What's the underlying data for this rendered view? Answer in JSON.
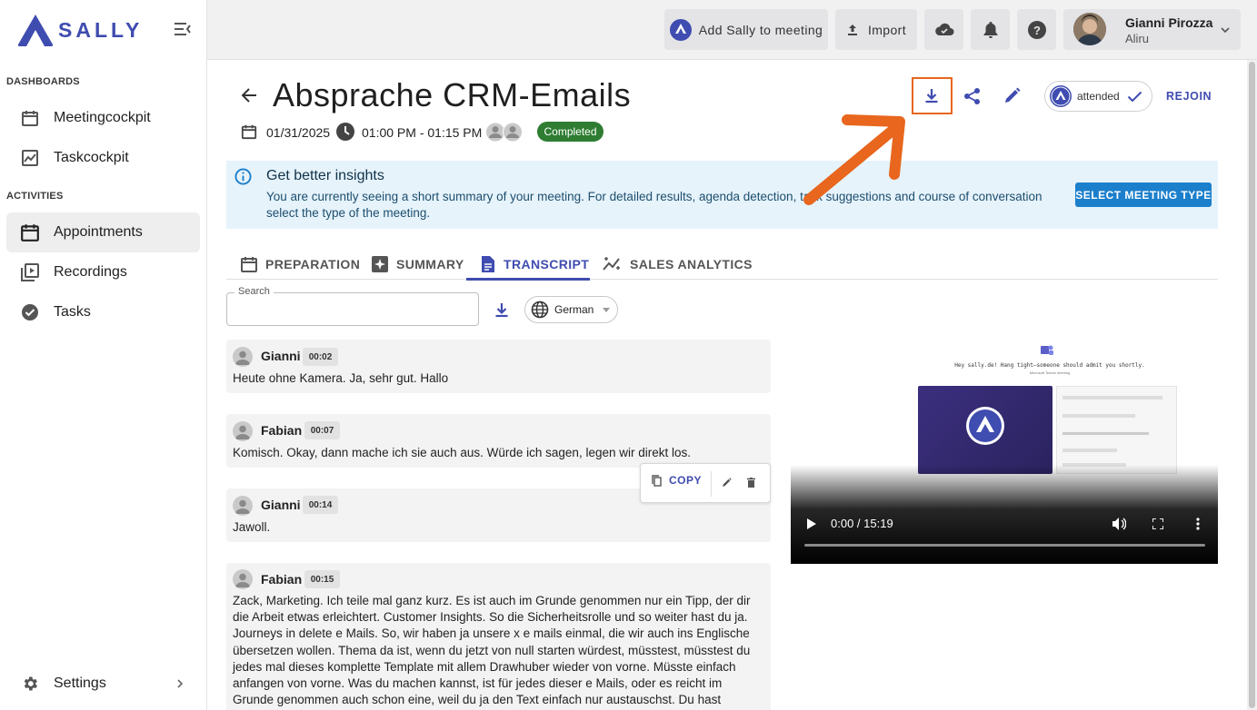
{
  "app": {
    "brand": "SALLY",
    "brand_color": "#3f4cb0"
  },
  "sidebar": {
    "sections": [
      {
        "title": "DASHBOARDS",
        "items": [
          {
            "label": "Meetingcockpit",
            "icon": "calendar-icon"
          },
          {
            "label": "Taskcockpit",
            "icon": "chart-icon"
          }
        ]
      },
      {
        "title": "ACTIVITIES",
        "items": [
          {
            "label": "Appointments",
            "icon": "calendar-icon",
            "active": true
          },
          {
            "label": "Recordings",
            "icon": "play-library-icon"
          },
          {
            "label": "Tasks",
            "icon": "check-circle-icon"
          }
        ]
      }
    ],
    "settings_label": "Settings"
  },
  "header": {
    "add_sally_label": "Add Sally to meeting",
    "import_label": "Import",
    "user_name": "Gianni Pirozza",
    "user_org": "Aliru"
  },
  "meeting": {
    "title": "Absprache CRM-Emails",
    "date": "01/31/2025",
    "time": "01:00 PM - 01:15 PM",
    "status": "Completed",
    "attended_label": "attended",
    "rejoin_label": "REJOIN"
  },
  "banner": {
    "heading": "Get better insights",
    "text": "You are currently seeing a short summary of your meeting. For detailed results, agenda detection, task suggestions and course of conversation select the type of the meeting.",
    "button": "SELECT MEETING TYPE"
  },
  "tabs": [
    {
      "label": "PREPARATION",
      "icon": "calendar-icon"
    },
    {
      "label": "SUMMARY",
      "icon": "summary-icon"
    },
    {
      "label": "TRANSCRIPT",
      "icon": "document-icon",
      "active": true
    },
    {
      "label": "SALES ANALYTICS",
      "icon": "analytics-icon"
    }
  ],
  "search": {
    "label": "Search",
    "value": ""
  },
  "language": "German",
  "transcript": [
    {
      "speaker": "Gianni",
      "time": "00:02",
      "text": "Heute ohne Kamera. Ja, sehr gut. Hallo"
    },
    {
      "speaker": "Fabian",
      "time": "00:07",
      "text": "Komisch. Okay, dann mache ich sie auch aus. Würde ich sagen, legen wir direkt los."
    },
    {
      "speaker": "Gianni",
      "time": "00:14",
      "text": "Jawoll."
    },
    {
      "speaker": "Fabian",
      "time": "00:15",
      "text": "Zack, Marketing. Ich teile mal ganz kurz. Es ist auch im Grunde genommen nur ein Tipp, der dir die Arbeit etwas erleichtert. Customer Insights. So die Sicherheitsrolle und so weiter hast du ja. Journeys in delete e Mails. So, wir haben ja unsere x e mails einmal, die wir auch ins Englische übersetzen wollen. Thema da ist, wenn du jetzt von null starten würdest, müsstest, müsstest du jedes mal dieses komplette Template mit allem Drawhuber wieder von vorne. Müsste einfach anfangen von vorne. Was du machen kannst, ist für jedes dieser e Mails, oder es reicht im Grunde genommen auch schon eine, weil du ja den Text einfach nur austauschst. Du hast einfach das hier mit hart eingecodet jetzt. Okay,"
    }
  ],
  "copy_label": "COPY",
  "video": {
    "time": "0:00 / 15:19",
    "thumb_text": "Hey sally.de! Hang tight—someone should admit you shortly.",
    "thumb_sub": "Microsoft Teams meeting"
  }
}
